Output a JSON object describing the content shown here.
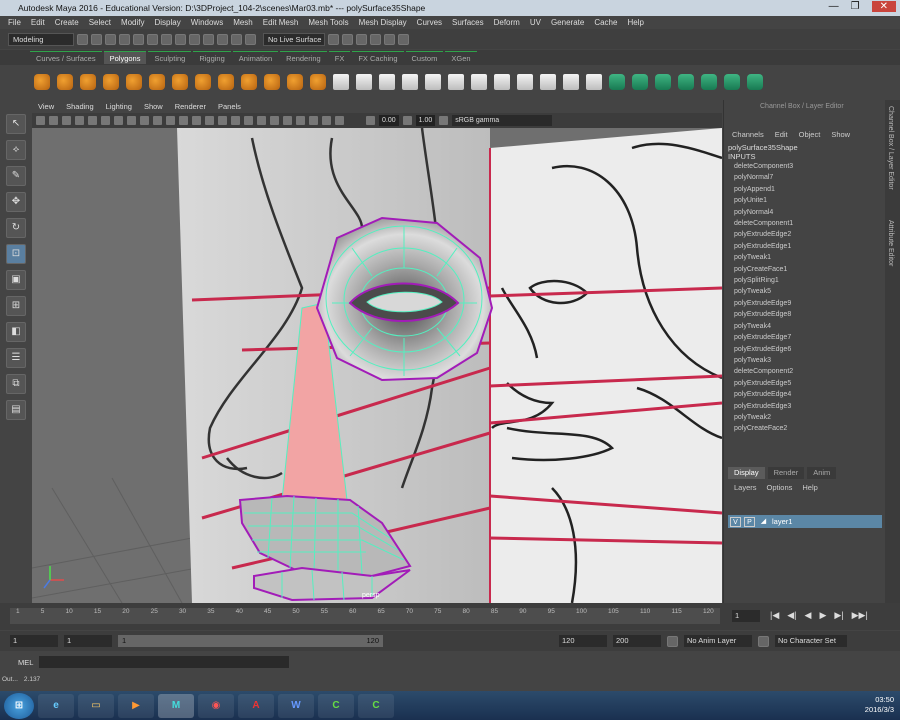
{
  "window": {
    "title": "Autodesk Maya 2016 - Educational Version: D:\\3DProject_104-2\\scenes\\Mar03.mb* --- polySurface35Shape",
    "controls": [
      "—",
      "❐",
      "✕"
    ]
  },
  "menubar": [
    "File",
    "Edit",
    "Create",
    "Select",
    "Modify",
    "Display",
    "Windows",
    "Mesh",
    "Edit Mesh",
    "Mesh Tools",
    "Mesh Display",
    "Curves",
    "Surfaces",
    "Deform",
    "UV",
    "Generate",
    "Cache",
    "Help"
  ],
  "statusline": {
    "mode": "Modeling",
    "live_surface": "No Live Surface"
  },
  "shelf": {
    "tabs": [
      "Curves / Surfaces",
      "Polygons",
      "Sculpting",
      "Rigging",
      "Animation",
      "Rendering",
      "FX",
      "FX Caching",
      "Custom",
      "XGen"
    ],
    "active_tab": "Polygons"
  },
  "viewport": {
    "menu": [
      "View",
      "Shading",
      "Lighting",
      "Show",
      "Renderer",
      "Panels"
    ],
    "near_value": "0.00",
    "far_value": "1.00",
    "color_space": "sRGB gamma",
    "camera_label": "persp"
  },
  "channel_box": {
    "title": "Channel Box / Layer Editor",
    "menu": [
      "Channels",
      "Edit",
      "Object",
      "Show"
    ],
    "shape": "polySurface35Shape",
    "inputs_label": "INPUTS",
    "inputs": [
      "deleteComponent3",
      "polyNormal7",
      "polyAppend1",
      "polyUnite1",
      "polyNormal4",
      "deleteComponent1",
      "polyExtrudeEdge2",
      "polyExtrudeEdge1",
      "polyTweak1",
      "polyCreateFace1",
      "polySplitRing1",
      "polyTweak5",
      "polyExtrudeEdge9",
      "polyExtrudeEdge8",
      "polyTweak4",
      "polyExtrudeEdge7",
      "polyExtrudeEdge6",
      "polyTweak3",
      "deleteComponent2",
      "polyExtrudeEdge5",
      "polyExtrudeEdge4",
      "polyExtrudeEdge3",
      "polyTweak2",
      "polyCreateFace2"
    ]
  },
  "layer_editor": {
    "tabs": [
      "Display",
      "Render",
      "Anim"
    ],
    "active_tab": "Display",
    "menu": [
      "Layers",
      "Options",
      "Help"
    ],
    "layer": {
      "v": "V",
      "p": "P",
      "name": "layer1"
    }
  },
  "side_tabs": [
    "Channel Box / Layer Editor",
    "Attribute Editor"
  ],
  "timeslider": {
    "ticks": [
      "1",
      "5",
      "10",
      "15",
      "20",
      "25",
      "30",
      "35",
      "40",
      "45",
      "50",
      "55",
      "60",
      "65",
      "70",
      "75",
      "80",
      "85",
      "90",
      "95",
      "100",
      "105",
      "110",
      "115",
      "120"
    ],
    "current_frame": "1",
    "play_controls": [
      "|◀",
      "◀|",
      "◀",
      "▶",
      "▶|",
      "▶▶|"
    ]
  },
  "range": {
    "start": "1",
    "playback_start": "1",
    "range_start": "1",
    "range_end": "120",
    "playback_end": "120",
    "end": "200",
    "anim_layer": "No Anim Layer",
    "character_set": "No Character Set"
  },
  "command_line": {
    "label": "MEL"
  },
  "mini_panel": [
    "Out...",
    "2.137"
  ],
  "taskbar": {
    "apps": [
      "IE",
      "Folder",
      "Media",
      "Maya",
      "Chrome",
      "Acrobat",
      "Word",
      "Camtasia",
      "Camtasia Rec"
    ],
    "active_app": "Maya",
    "time": "03:50",
    "date": "2016/3/3"
  },
  "colors": {
    "accent_green": "#2fa34a",
    "wire_cyan": "#54f0c0",
    "wire_magenta": "#a21cb8",
    "guide_red": "#c8294d",
    "selected_face": "#f2a4a4"
  }
}
